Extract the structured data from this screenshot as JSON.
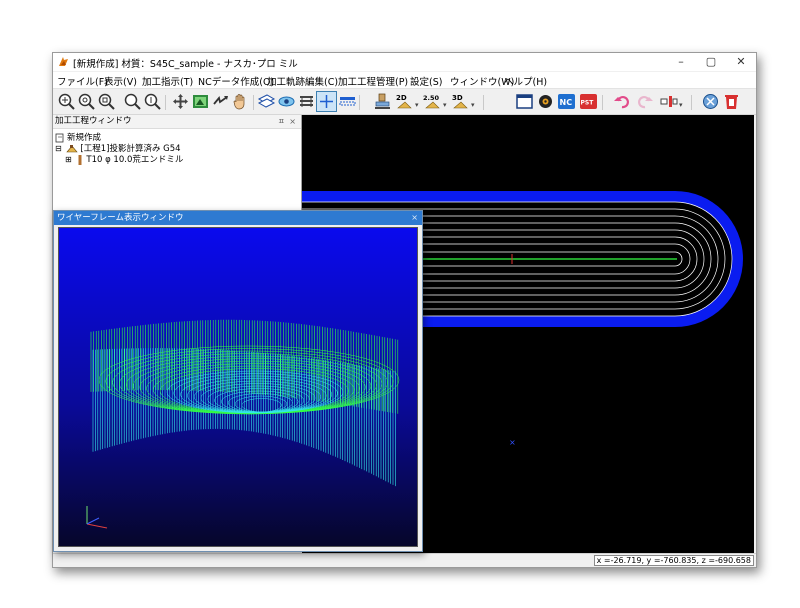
{
  "window": {
    "title": "[新規作成] 材質：S45C_sample - ナスカ･プロ ミル",
    "controls": {
      "minimize": "–",
      "maximize": "▢",
      "close": "✕"
    }
  },
  "menu": {
    "items": [
      "ファイル(F)",
      "表示(V)",
      "加工指示(T)",
      "NCデータ作成(O)",
      "加工軌跡編集(C)",
      "加工工程管理(P)",
      "設定(S)",
      "ウィンドウ(W)",
      "ヘルプ(H)"
    ]
  },
  "toolbar": {
    "icons": [
      "zoom-in-icon",
      "zoom-out-icon",
      "zoom-fit-icon",
      "magnify-icon",
      "zoom-area-icon",
      "pan-move-icon",
      "view-3d-icon",
      "rotate-icon",
      "hand-icon",
      "slice-icon",
      "eye-icon",
      "layers-icon",
      "crosshair-icon",
      "grid-icon",
      "tool-setup-icon",
      "dim-2d-icon",
      "scale-250-icon",
      "dim-3d-icon",
      "window-icon",
      "gear-icon",
      "nc-icon",
      "pst-icon",
      "undo-icon",
      "redo-icon",
      "split-icon",
      "clear-icon",
      "delete-icon"
    ],
    "label_2d": "2D",
    "label_250": "2.50",
    "label_3d": "3D",
    "label_nc": "NC",
    "label_pst": "PST"
  },
  "process_panel": {
    "title": "加工工程ウィンドウ",
    "pin": "ㅍ",
    "close": "×",
    "tree": {
      "root": "新規作成",
      "process": "[工程1]投影計算済み G54",
      "tool": "T10 φ 10.0荒エンドミル"
    }
  },
  "wireframe_window": {
    "title": "ワイヤーフレーム表示ウィンドウ",
    "close": "×"
  },
  "status": {
    "coordinates": "x =-26.719, y =-760.835, z =-690.658"
  },
  "colors": {
    "viewport_bg": "#000000",
    "toolpath_blue": "#0a1cf0",
    "toolpath_white": "#ffffff",
    "wire_green": "#33ff44",
    "wire_cyan": "#33e8e8",
    "wire_bg_top": "#0a0aee",
    "wire_bg_bottom": "#06062a",
    "titlebar_blue": "#2e7ad1"
  }
}
